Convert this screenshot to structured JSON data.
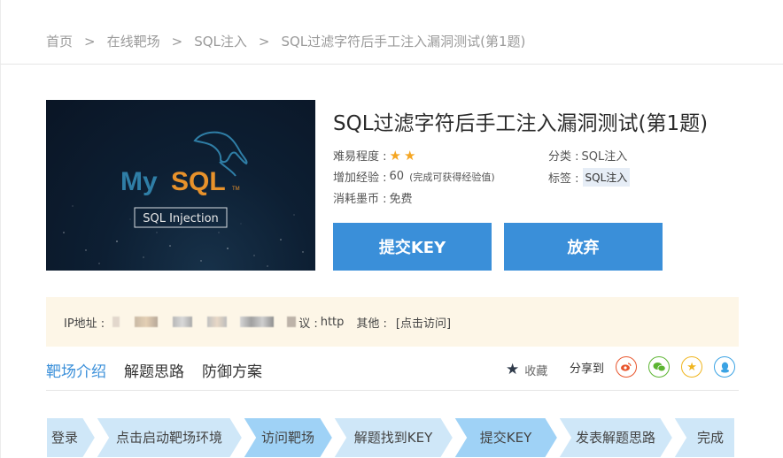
{
  "breadcrumb": [
    "首页",
    "在线靶场",
    "SQL注入",
    "SQL过滤字符后手工注入漏洞测试(第1题)"
  ],
  "breadcrumb_separator": ">",
  "cover": {
    "logo_my": "My",
    "logo_sql": "SQL",
    "tm": "TM",
    "subtitle": "SQL Injection"
  },
  "challenge": {
    "title": "SQL过滤字符后手工注入漏洞测试(第1题)",
    "difficulty_label": "难易程度 :",
    "difficulty_stars": 2,
    "exp_label": "增加经验 :",
    "exp_value": "60",
    "exp_note": "(完成可获得经验值)",
    "coin_label": "消耗墨币 :",
    "coin_value": "免费",
    "category_label": "分类 :",
    "category_value": "SQL注入",
    "tags_label": "标签 :",
    "tag_value": "SQL注入"
  },
  "buttons": {
    "submit": "提交KEY",
    "abandon": "放弃"
  },
  "env": {
    "ip_label": "IP地址 :",
    "protocol_label": "议 :",
    "protocol_value": "http",
    "other_label": "其他 :",
    "visit_link": "[点击访问]"
  },
  "tabs": [
    "靶场介绍",
    "解题思路",
    "防御方案"
  ],
  "favorite_label": "收藏",
  "share_label": "分享到",
  "steps": [
    "登录",
    "点击启动靶场环境",
    "访问靶场",
    "解题找到KEY",
    "提交KEY",
    "发表解题思路",
    "完成"
  ],
  "colors": {
    "accent": "#3a8fd9",
    "star": "#f5a623",
    "step_light": "#cfe7f8",
    "step_dark": "#9fd2f6",
    "weibo": "#e8552c",
    "wechat": "#5cb531",
    "qzone": "#f0b51e",
    "qq": "#3ba3e4"
  }
}
